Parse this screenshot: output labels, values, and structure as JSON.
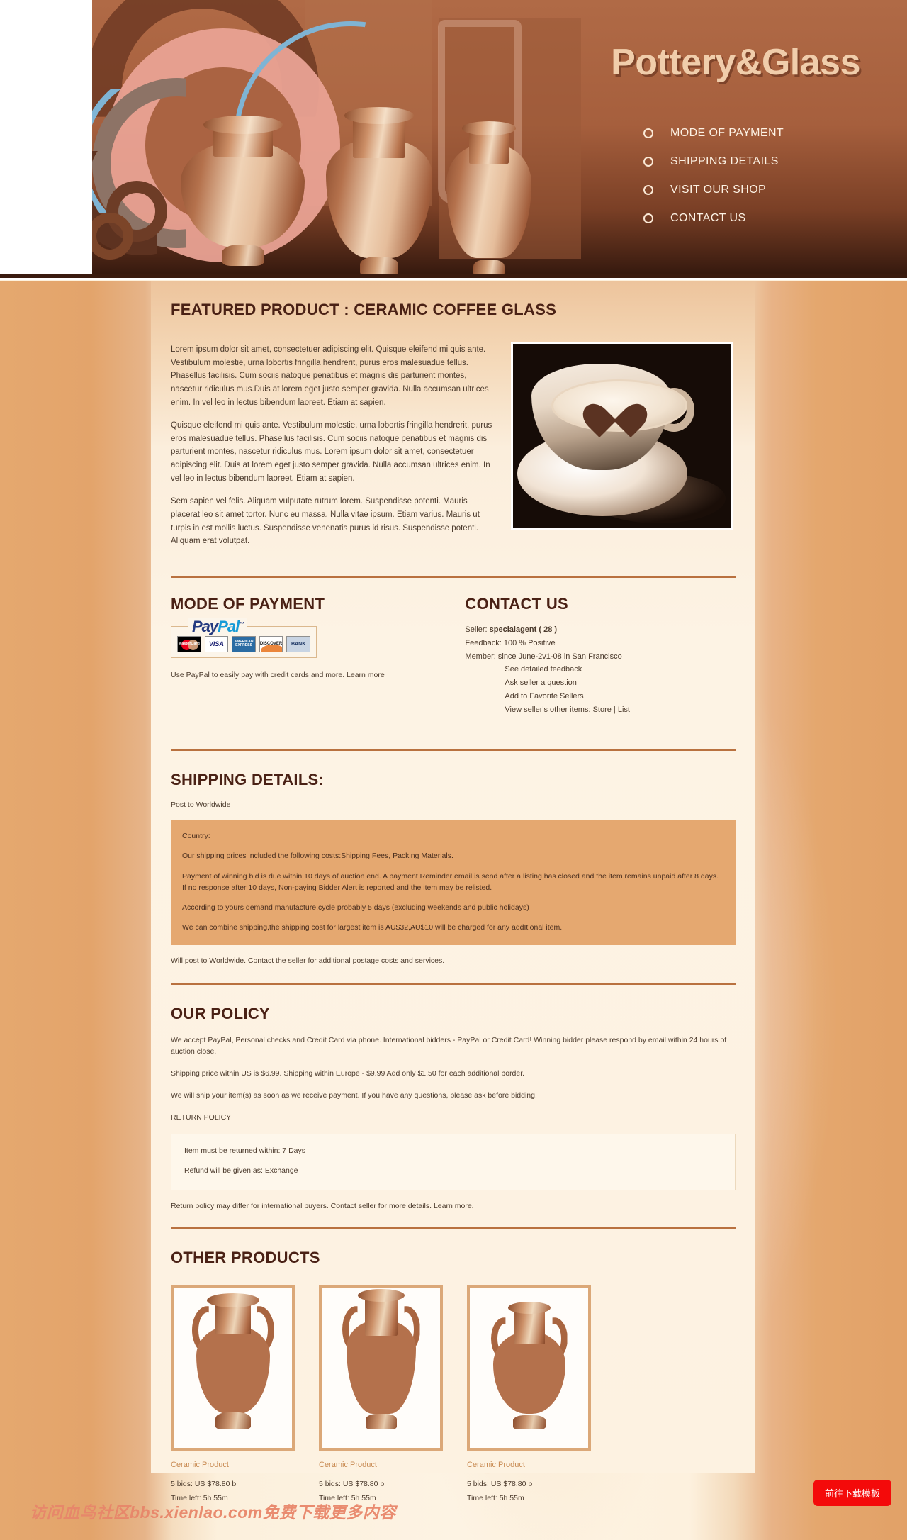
{
  "header": {
    "title": "Pottery&Glass",
    "nav": [
      {
        "label": "MODE OF PAYMENT"
      },
      {
        "label": "SHIPPING DETAILS"
      },
      {
        "label": "VISIT OUR SHOP"
      },
      {
        "label": "CONTACT US"
      }
    ]
  },
  "featured": {
    "title": "FEATURED PRODUCT : CERAMIC COFFEE GLASS",
    "paragraphs": [
      "Lorem ipsum dolor sit amet, consectetuer adipiscing elit. Quisque eleifend mi quis ante. Vestibulum molestie, urna lobortis fringilla hendrerit, purus eros malesuadue tellus. Phasellus facilisis. Cum sociis natoque penatibus et magnis dis parturient montes, nascetur ridiculus mus.Duis at lorem eget justo semper gravida. Nulla accumsan ultrices enim. In vel leo in lectus bibendum laoreet. Etiam at sapien.",
      "Quisque eleifend mi quis ante. Vestibulum molestie, urna lobortis fringilla hendrerit, purus eros malesuadue tellus. Phasellus facilisis. Cum sociis natoque penatibus et magnis dis parturient montes, nascetur ridiculus mus. Lorem ipsum dolor sit amet, consectetuer adipiscing elit. Duis at lorem eget justo semper gravida. Nulla accumsan ultrices enim. In vel leo in lectus bibendum laoreet. Etiam at sapien.",
      "Sem sapien vel felis. Aliquam vulputate rutrum lorem. Suspendisse potenti. Mauris placerat leo sit amet tortor. Nunc eu massa. Nulla vitae ipsum. Etiam varius. Mauris ut turpis in est mollis luctus. Suspendisse venenatis purus id risus. Suspendisse potenti. Aliquam erat volutpat."
    ],
    "image_alt": "cappuccino-cup-with-heart-foam"
  },
  "payment": {
    "title": "MODE OF PAYMENT",
    "paypal_brand_pay": "Pay",
    "paypal_brand_pal": "Pal",
    "paypal_tm": "™",
    "cards": [
      {
        "name": "mastercard-card",
        "label": "MasterCard"
      },
      {
        "name": "visa-card",
        "label": "VISA"
      },
      {
        "name": "amex-card",
        "label": "AMERICAN EXPRESS"
      },
      {
        "name": "discover-card",
        "label": "DISCOVER"
      },
      {
        "name": "bank-card",
        "label": "BANK"
      }
    ],
    "note": "Use PayPal to easily pay with credit cards and more. Learn more"
  },
  "contact": {
    "title": "CONTACT US",
    "seller_label": "Seller:",
    "seller_value": "specialagent ( 28 )",
    "feedback_label": "Feedback:",
    "feedback_value": "100 % Positive",
    "member_label": "Member:",
    "member_value": "since June-2v1-08 in San Francisco",
    "links": [
      "See detailed feedback",
      "Ask seller a question",
      "Add to Favorite Sellers",
      "View seller's other items: Store | List"
    ]
  },
  "shipping": {
    "title": "SHIPPING DETAILS:",
    "post_to": "Post to Worldwide",
    "panel": [
      "Country:",
      "Our shipping prices included the following costs:Shipping Fees, Packing Materials.",
      "Payment of winning bid is due within 10 days of auction end. A payment Reminder email is send after a listing has closed and the item remains unpaid after 8 days. If no response after 10 days, Non-paying Bidder Alert is reported and the item may be relisted.",
      "According to yours demand manufacture,cycle probably 5 days (excluding weekends and public holidays)",
      "We can combine shipping,the shipping cost for largest item is AU$32,AU$10 will be charged for any addItional item."
    ],
    "after_note": "Will post to Worldwide. Contact the seller for additional postage costs and services."
  },
  "policy": {
    "title": "OUR POLICY",
    "paragraphs": [
      "We accept PayPal, Personal checks and Credit Card via phone. International bidders - PayPal or Credit Card! Winning bidder please respond by email within 24 hours of auction close.",
      "Shipping price within US is $6.99. Shipping within Europe - $9.99 Add only $1.50 for each additional border.",
      "We will ship your item(s) as soon as we receive payment. If you have any questions, please ask before bidding.",
      "RETURN POLICY"
    ],
    "return_box": [
      "Item must be returned within: 7 Days",
      "Refund will be given as: Exchange"
    ],
    "return_note": "Return policy may differ for international buyers. Contact seller for more details. Learn more."
  },
  "other_products": {
    "title": "OTHER PRODUCTS",
    "items": [
      {
        "link": "Ceramic Product",
        "bids": "5 bids: US $78.80 b",
        "time": "Time left: 5h 55m"
      },
      {
        "link": "Ceramic Product",
        "bids": "5 bids: US $78.80 b",
        "time": "Time left: 5h 55m"
      },
      {
        "link": "Ceramic Product",
        "bids": "5 bids: US $78.80 b",
        "time": "Time left: 5h 55m"
      }
    ]
  },
  "overlay": {
    "watermark": "访问血鸟社区bbs.xienlao.com免费下载更多内容",
    "download_button": "前往下载模板"
  },
  "colors": {
    "banner_brown": "#a65f3d",
    "banner_dark": "#32170d",
    "title_cream": "#f0cdab",
    "accent_rule": "#b9713f",
    "panel_orange": "#e5a870",
    "link_tan": "#c88a52",
    "page_edge": "#e3a46b",
    "sheet_cream": "#fdf2e1",
    "download_red": "#f40a0a",
    "watermark_red": "#e8866a"
  }
}
